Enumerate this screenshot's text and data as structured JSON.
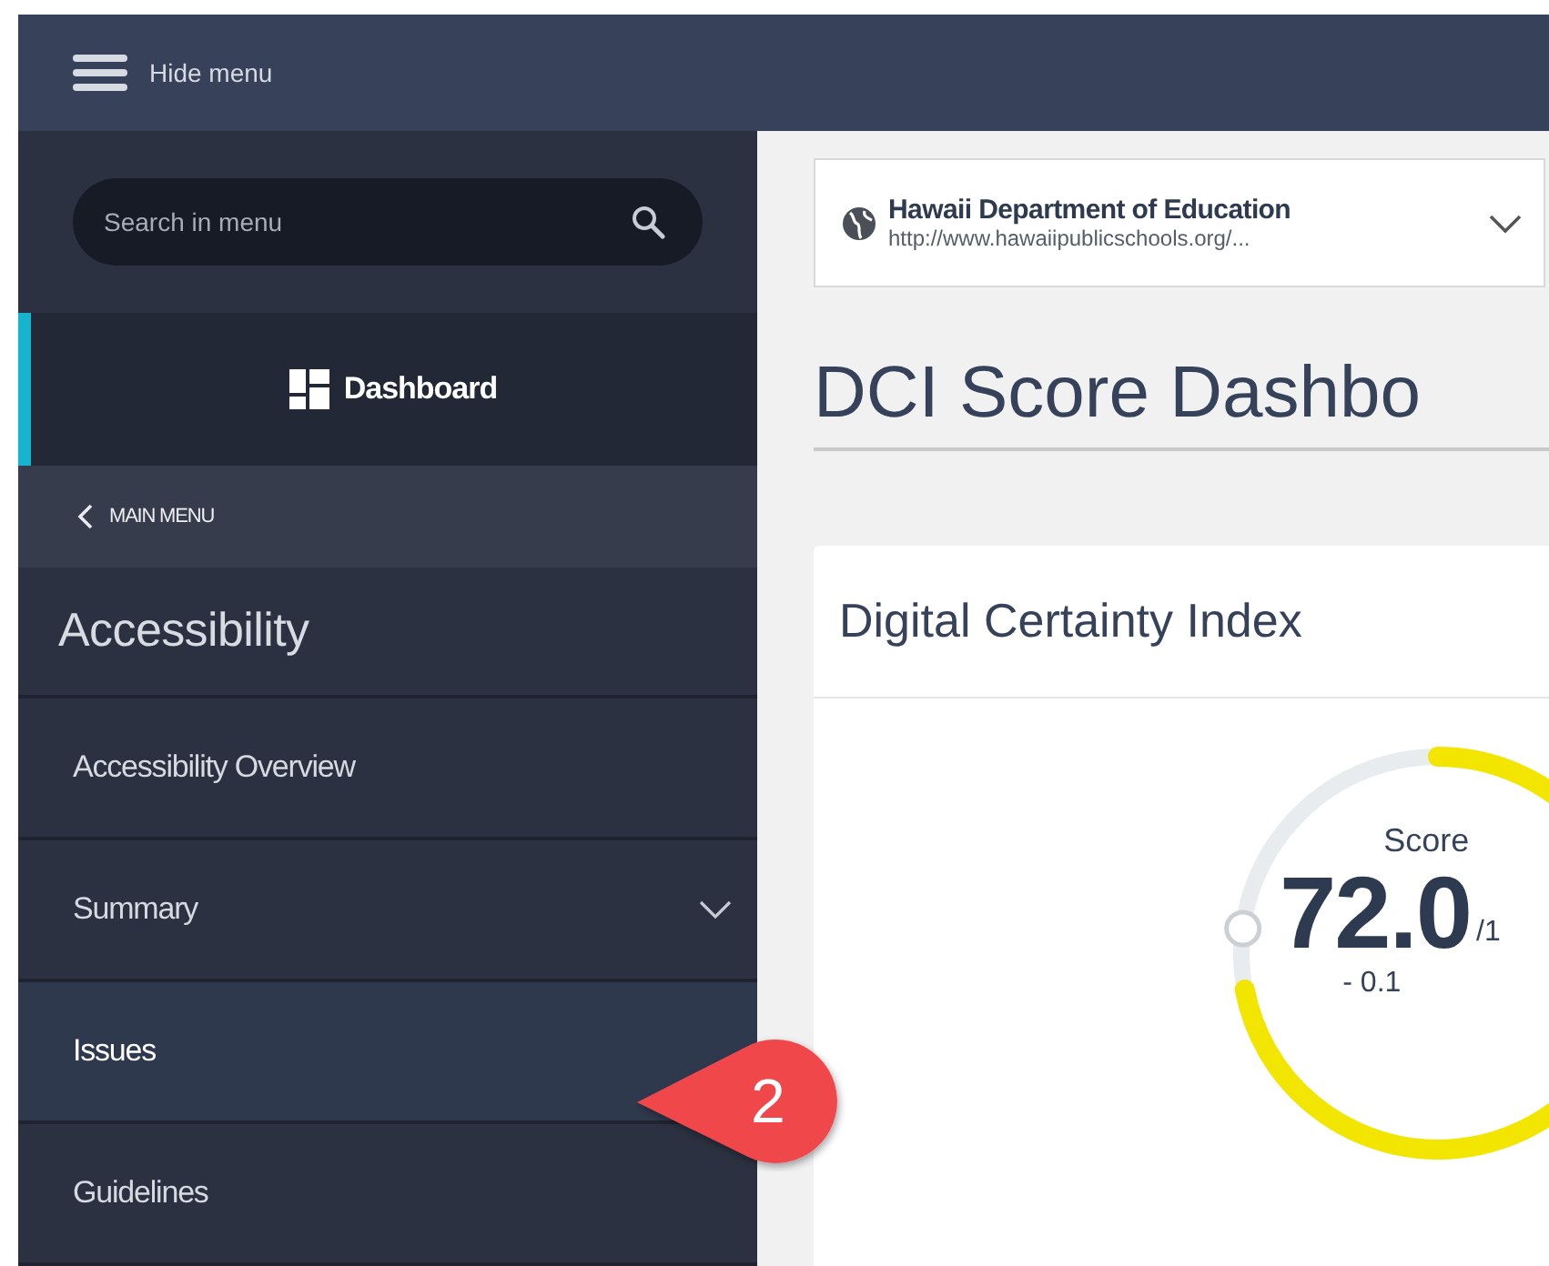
{
  "topbar": {
    "menu_label": "Hide menu"
  },
  "sidebar": {
    "search": {
      "placeholder": "Search in menu"
    },
    "dashboard": {
      "label": "Dashboard",
      "selected": true
    },
    "back_label": "MAIN MENU",
    "section_title": "Accessibility",
    "items": [
      {
        "label": "Accessibility Overview",
        "selected": false,
        "expandable": false
      },
      {
        "label": "Summary",
        "selected": false,
        "expandable": true
      },
      {
        "label": "Issues",
        "selected": true,
        "expandable": false
      },
      {
        "label": "Guidelines",
        "selected": false,
        "expandable": false
      }
    ]
  },
  "site_selector": {
    "name": "Hawaii Department of Education",
    "url": "http://www.hawaiipublicschools.org/..."
  },
  "page_title": "DCI Score Dashbo",
  "card": {
    "title": "Digital Certainty Index",
    "gauge": {
      "label": "Score",
      "value": "72.0",
      "max": "/1",
      "change": "- 0.1"
    }
  },
  "callout": {
    "number": "2"
  }
}
